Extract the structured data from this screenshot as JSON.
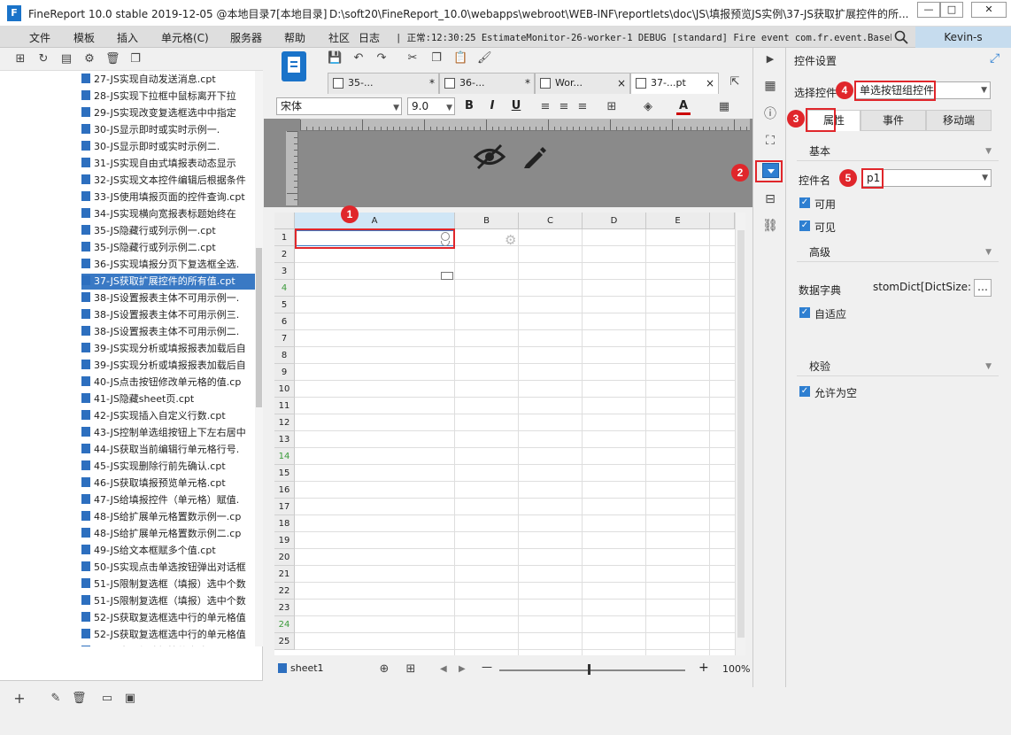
{
  "window": {
    "title": "FineReport 10.0 stable 2019-12-05 @本地目录7[本地目录]",
    "path": "D:\\soft20\\FineReport_10.0\\webapps\\webroot\\WEB-INF\\reportlets\\doc\\JS\\填报预览JS实例\\37-JS获取扩展控件的所...",
    "min": "—",
    "max": "□",
    "close": "✕"
  },
  "menu": {
    "items": [
      "文件",
      "模板",
      "插入",
      "单元格(C)",
      "服务器",
      "帮助",
      "社区",
      "日志"
    ],
    "log": "| 正常:12:30:25 EstimateMonitor-26-worker-1 DEBUG [standard] Fire event com.fr.event.BaseEve...",
    "user": "Kevin-s"
  },
  "files": [
    "27-JS实现自动发送消息.cpt",
    "28-JS实现下拉框中鼠标离开下拉",
    "29-JS实现改变复选框选中中指定",
    "30-JS显示即时或实时示例一.",
    "30-JS显示即时或实时示例二.",
    "31-JS实现自由式填报表动态显示",
    "32-JS实现文本控件编辑后根据条件",
    "33-JS使用填报页面的控件查询.cpt",
    "34-JS实现横向宽报表标题始终在",
    "35-JS隐藏行或列示例一.cpt",
    "35-JS隐藏行或列示例二.cpt",
    "36-JS实现填报分页下复选框全选.",
    "37-JS获取扩展控件的所有值.cpt",
    "38-JS设置报表主体不可用示例一.",
    "38-JS设置报表主体不可用示例三.",
    "38-JS设置报表主体不可用示例二.",
    "39-JS实现分析或填报报表加载后自",
    "39-JS实现分析或填报报表加载后自",
    "40-JS点击按钮修改单元格的值.cp",
    "41-JS隐藏sheet页.cpt",
    "42-JS实现插入自定义行数.cpt",
    "43-JS控制单选组按钮上下左右居中",
    "44-JS获取当前编辑行单元格行号.",
    "45-JS实现删除行前先确认.cpt",
    "46-JS获取填报预览单元格.cpt",
    "47-JS给填报控件（单元格）赋值.",
    "48-JS给扩展单元格置数示例一.cp",
    "48-JS给扩展单元格置数示例二.cp",
    "49-JS给文本框赋多个值.cpt",
    "50-JS实现点击单选按钮弹出对话框",
    "51-JS限制复选框（填报）选中个数",
    "51-JS限制复选框（填报）选中个数",
    "52-JS获取复选框选中行的单元格值",
    "52-JS获取复选框选中行的单元格值",
    "53-JS实现复选框控件全选.cpt"
  ],
  "tabs": [
    {
      "label": "35-...",
      "close": "*"
    },
    {
      "label": "36-...",
      "close": "*"
    },
    {
      "label": "Wor...",
      "close": "×"
    },
    {
      "label": "37-...pt",
      "close": "×"
    }
  ],
  "toolbar": {
    "font": "宋体",
    "size": "9.0",
    "bold": "B",
    "italic": "I",
    "underline": "U",
    "fontcolor": "A"
  },
  "grid": {
    "columns": [
      "A",
      "B",
      "C",
      "D",
      "E"
    ],
    "rows": [
      "1",
      "2",
      "3",
      "4",
      "5",
      "6",
      "7",
      "8",
      "9",
      "10",
      "11",
      "12",
      "13",
      "14",
      "15",
      "16",
      "17",
      "18",
      "19",
      "20",
      "21",
      "22",
      "23",
      "24",
      "25"
    ]
  },
  "sheet": {
    "name": "sheet1",
    "zoom": "100%",
    "minus": "—",
    "plus": "+"
  },
  "panel": {
    "title": "控件设置",
    "choose_label": "选择控件",
    "choose_value": "单选按钮组控件",
    "tab_props": "属性",
    "tab_events": "事件",
    "tab_mobile": "移动端",
    "section_basic": "基本",
    "name_label": "控件名",
    "name_value": "p1",
    "enabled": "可用",
    "visible": "可见",
    "section_advanced": "高级",
    "dict_label": "数据字典",
    "dict_value": "stomDict[DictSize:3]",
    "autofit": "自适应",
    "section_validate": "校验",
    "allow_empty": "允许为空"
  },
  "badges": [
    "1",
    "2",
    "3",
    "4",
    "5"
  ],
  "colors": {
    "annotation": "#e0262b",
    "accent": "#2e7fd1",
    "selection": "#3a79c4"
  }
}
